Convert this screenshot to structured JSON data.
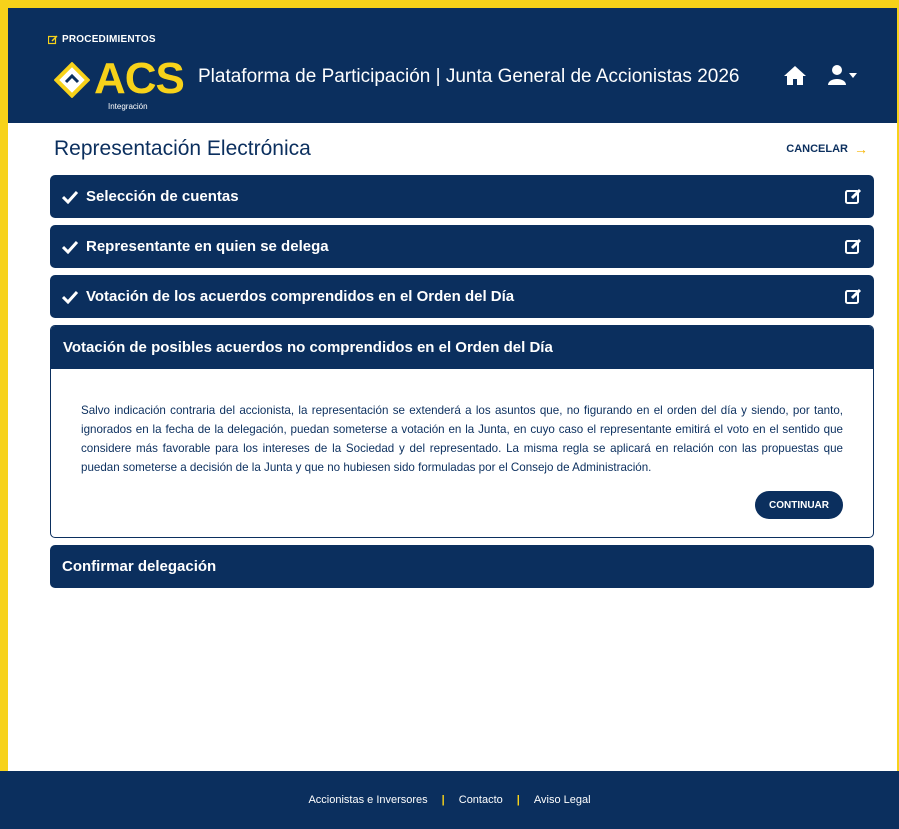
{
  "header": {
    "procedures_label": "PROCEDIMIENTOS",
    "logo_text": "ACS",
    "logo_subtitle": "Integración",
    "app_title": "Plataforma de Participación | Junta General de Accionistas 2026"
  },
  "page": {
    "title": "Representación Electrónica",
    "cancel_label": "CANCELAR"
  },
  "steps": [
    {
      "label": "Selección de cuentas",
      "completed": true
    },
    {
      "label": "Representante en quien se delega",
      "completed": true
    },
    {
      "label": "Votación de los acuerdos comprendidos en el Orden del Día",
      "completed": true
    }
  ],
  "active_panel": {
    "title": "Votación de posibles acuerdos no comprendidos en el Orden del Día",
    "body": "Salvo indicación contraria del accionista, la representación se extenderá a los asuntos que, no figurando en el orden del día y siendo, por tanto, ignorados en la fecha de la delegación, puedan someterse a votación en la Junta, en cuyo caso el representante emitirá el voto en el sentido que considere más favorable para los intereses de la Sociedad y del representado. La misma regla se aplicará en relación con las propuestas que puedan someterse a decisión de la Junta y que no hubiesen sido formuladas por el Consejo de Administración.",
    "continue_label": "CONTINUAR"
  },
  "final_step": {
    "label": "Confirmar delegación"
  },
  "footer": {
    "links": [
      "Accionistas e Inversores",
      "Contacto",
      "Aviso Legal"
    ]
  },
  "colors": {
    "navy": "#0b2f5e",
    "accent_yellow": "#f7d21a"
  }
}
